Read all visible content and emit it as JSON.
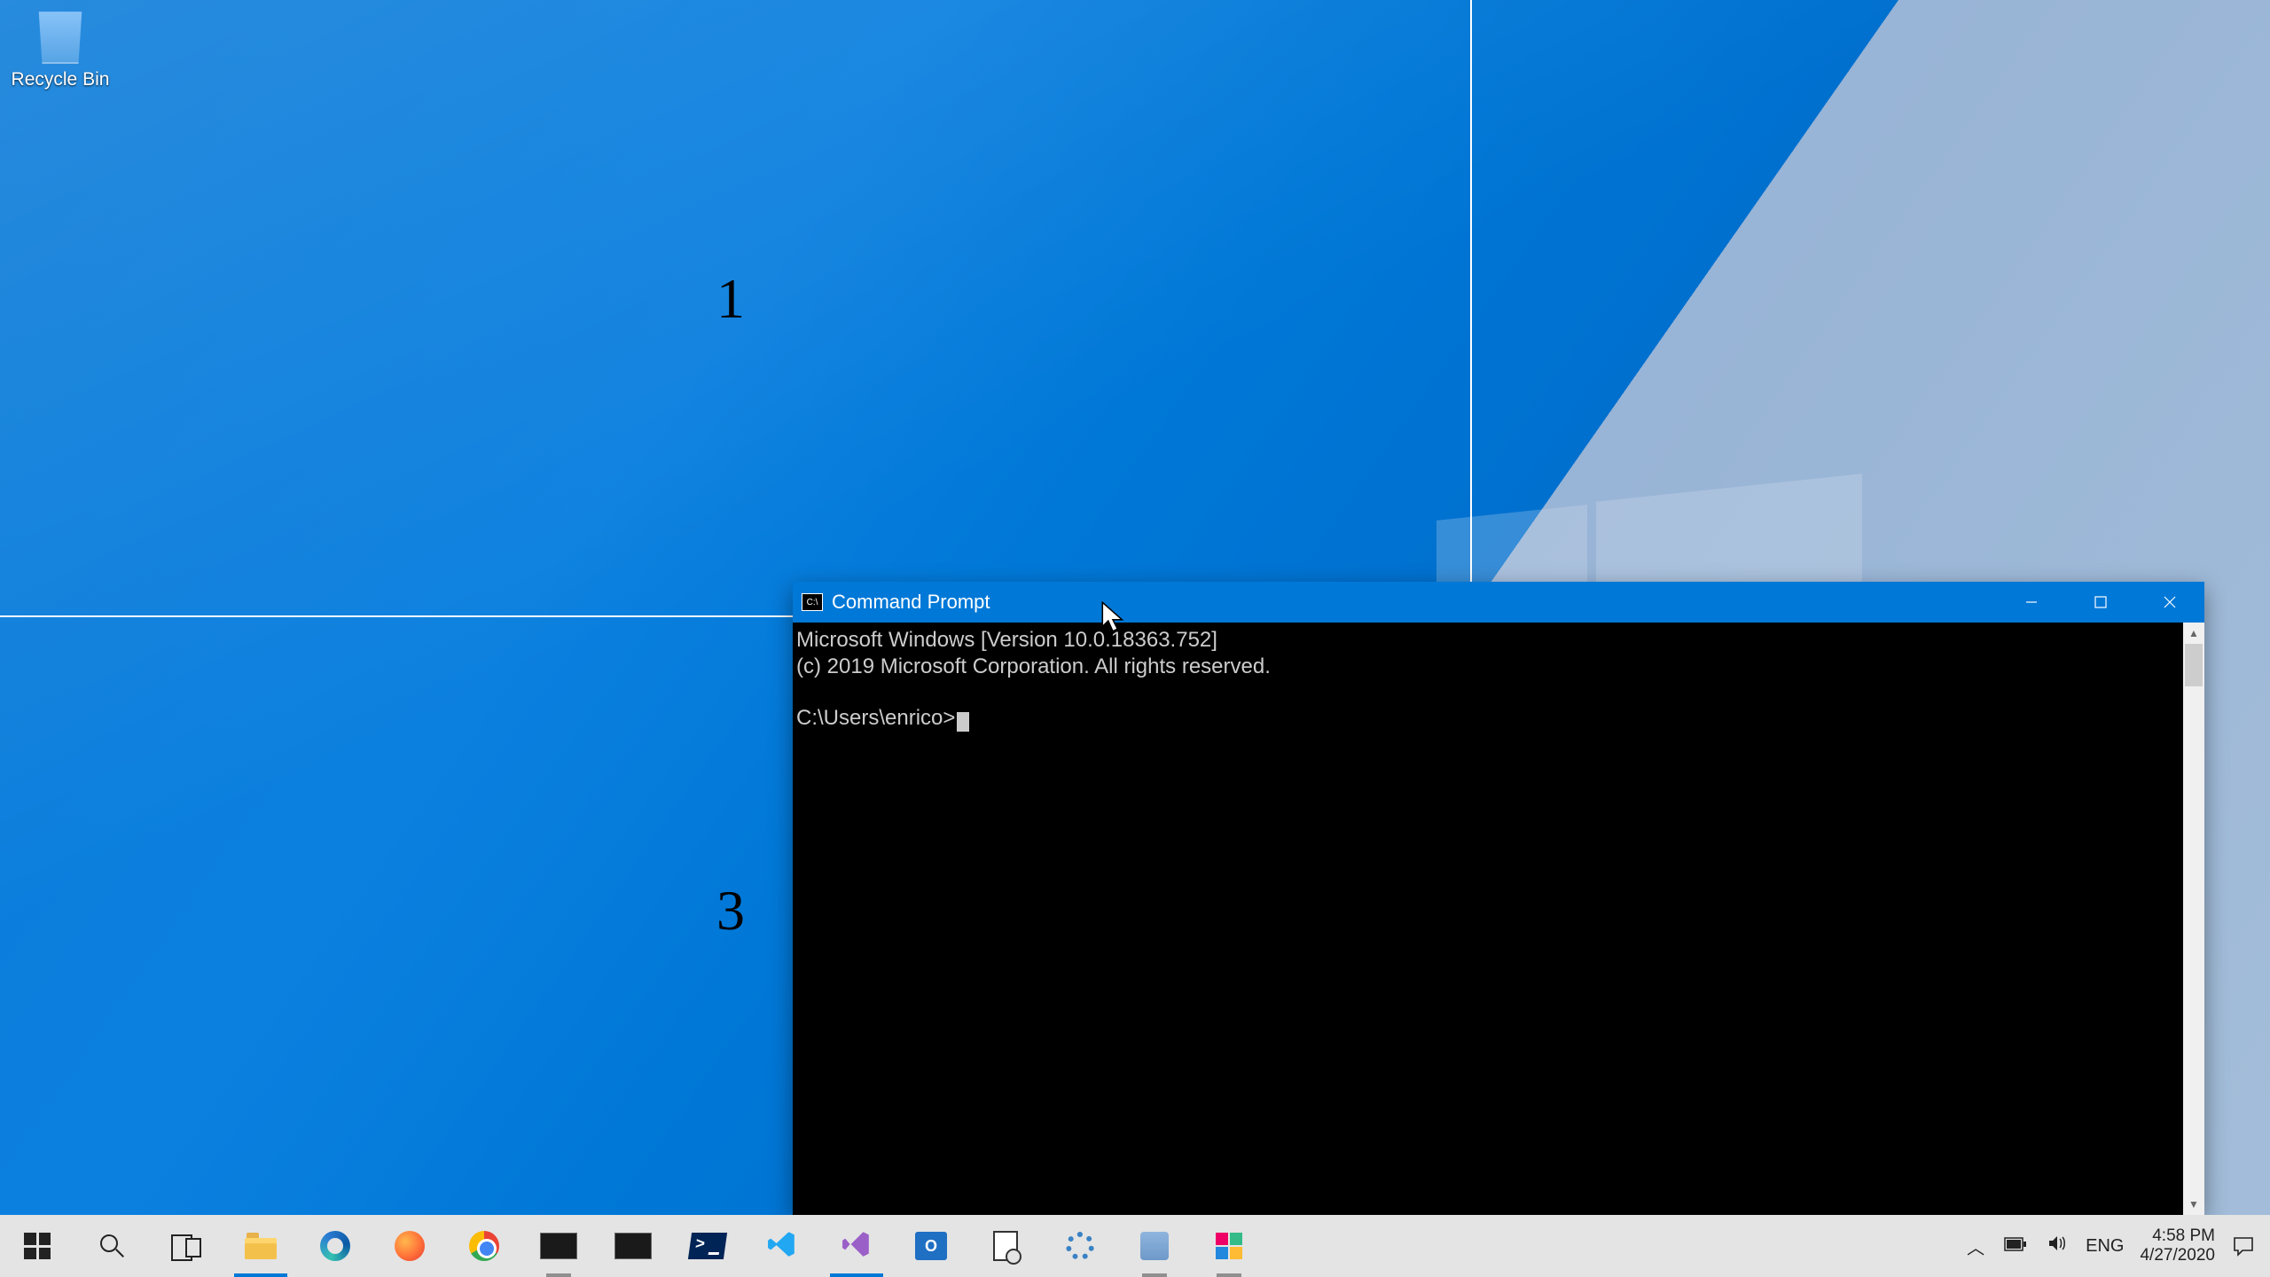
{
  "desktop": {
    "icons": {
      "recycle_bin": "Recycle Bin"
    }
  },
  "zones": {
    "z1": "1",
    "z3": "3"
  },
  "cmd": {
    "title": "Command Prompt",
    "icon_text": "C:\\",
    "line1": "Microsoft Windows [Version 10.0.18363.752]",
    "line2": "(c) 2019 Microsoft Corporation. All rights reserved.",
    "prompt": "C:\\Users\\enrico>"
  },
  "taskbar": {
    "lang": "ENG",
    "time": "4:58 PM",
    "date": "4/27/2020"
  }
}
